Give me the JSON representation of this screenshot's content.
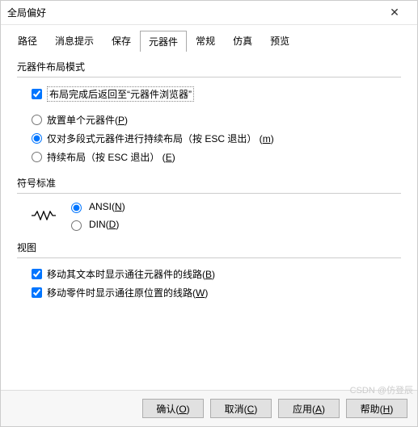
{
  "window": {
    "title": "全局偏好",
    "close_icon": "✕"
  },
  "tabs": [
    {
      "label": "路径"
    },
    {
      "label": "消息提示"
    },
    {
      "label": "保存"
    },
    {
      "label": "元器件",
      "active": true
    },
    {
      "label": "常规"
    },
    {
      "label": "仿真"
    },
    {
      "label": "预览"
    }
  ],
  "layoutMode": {
    "legend": "元器件布局模式",
    "returnToBrowser": {
      "label": "布局完成后返回至“元器件浏览器”",
      "checked": true
    },
    "placeSingle": {
      "label": "放置单个元器件",
      "hotkey": "P"
    },
    "continuousMultiSeg": {
      "label": "仅对多段式元器件进行持续布局（按 ESC 退出）",
      "hotkey": "m"
    },
    "continuous": {
      "label": "持续布局（按 ESC 退出）",
      "hotkey": "E"
    }
  },
  "symbolStd": {
    "legend": "符号标准",
    "ansi": {
      "label": "ANSI",
      "hotkey": "N"
    },
    "din": {
      "label": "DIN",
      "hotkey": "D"
    }
  },
  "view": {
    "legend": "视图",
    "moveText": {
      "label": "移动其文本时显示通往元器件的线路",
      "hotkey": "B",
      "checked": true
    },
    "movePart": {
      "label": "移动零件时显示通往原位置的线路",
      "hotkey": "W",
      "checked": true
    }
  },
  "buttons": {
    "ok": {
      "label": "确认",
      "hotkey": "O"
    },
    "cancel": {
      "label": "取消",
      "hotkey": "C"
    },
    "apply": {
      "label": "应用",
      "hotkey": "A"
    },
    "help": {
      "label": "帮助",
      "hotkey": "H"
    }
  },
  "watermark": "CSDN @仿登辰"
}
